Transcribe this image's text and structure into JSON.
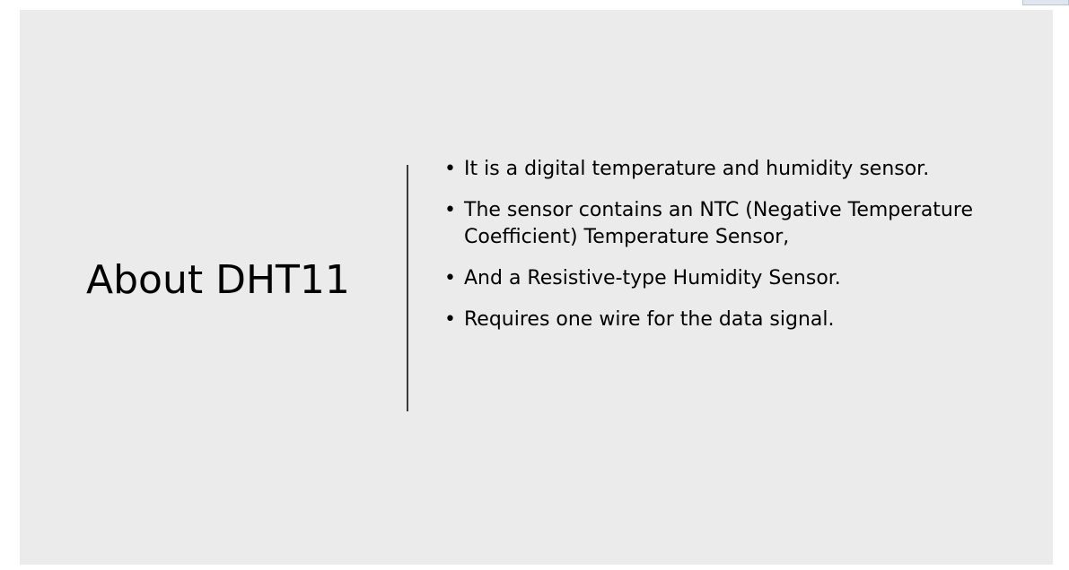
{
  "slide": {
    "title": "About DHT11",
    "bullets": [
      {
        "marker": "•",
        "text": "It is a digital temperature and humidity sensor."
      },
      {
        "marker": "•",
        "text": "The sensor contains an NTC (Negative Temperature Coefficient) Temperature Sensor,"
      },
      {
        "marker": "•",
        "text": "And a Resistive-type Humidity Sensor."
      },
      {
        "marker": "•",
        "text": "Requires one wire for the data signal."
      }
    ]
  },
  "colors": {
    "slide_background": "#ebebeb",
    "text": "#000000",
    "divider": "#3a3a3a"
  }
}
